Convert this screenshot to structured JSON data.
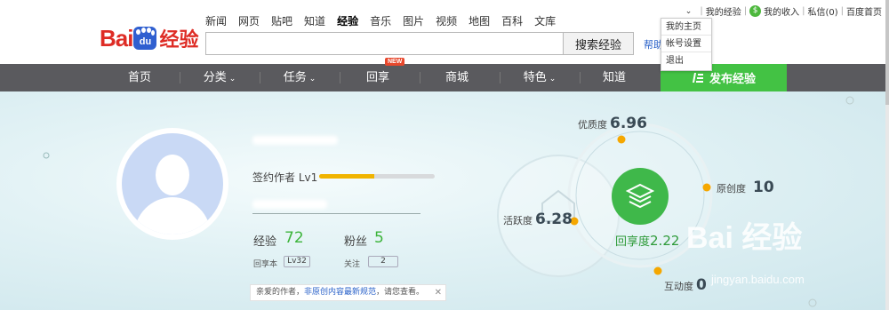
{
  "logo": {
    "bai": "Bai",
    "du": "du",
    "brand": "经验"
  },
  "topnav": [
    {
      "label": "新闻",
      "active": false
    },
    {
      "label": "网页",
      "active": false
    },
    {
      "label": "贴吧",
      "active": false
    },
    {
      "label": "知道",
      "active": false
    },
    {
      "label": "经验",
      "active": true
    },
    {
      "label": "音乐",
      "active": false
    },
    {
      "label": "图片",
      "active": false
    },
    {
      "label": "视频",
      "active": false
    },
    {
      "label": "地图",
      "active": false
    },
    {
      "label": "百科",
      "active": false
    },
    {
      "label": "文库",
      "active": false
    }
  ],
  "search": {
    "button_label": "搜索经验",
    "help_link": "帮助"
  },
  "userbar": {
    "dropdown_arrow": "⌄",
    "my_experience": "我的经验",
    "my_income": "我的收入",
    "money_icon": "$",
    "messages": "私信(0)",
    "baidu_home": "百度首页"
  },
  "dropdown": {
    "items": [
      "我的主页",
      "帐号设置",
      "退出"
    ]
  },
  "mainnav": {
    "items": [
      "首页",
      "分类",
      "任务",
      "回享",
      "商城",
      "特色",
      "知道"
    ],
    "arrows": [
      "",
      "⌄",
      "⌄",
      "",
      "",
      "⌄",
      ""
    ],
    "new_badge": "NEW",
    "publish_label": "发布经验"
  },
  "profile": {
    "level_label": "签约作者 Lv1",
    "level_progress": 0.48,
    "experience_label": "经验",
    "experience_value": "72",
    "fans_label": "粉丝",
    "fans_value": "5",
    "huixiang_label": "回享本",
    "huixiang_value": "Lv32",
    "follow_label": "关注",
    "follow_value": "2",
    "notice_prefix": "亲爱的作者，",
    "notice_link": "非原创内容最新规范",
    "notice_suffix": "，请您查看。",
    "notice_close": "✕"
  },
  "scores": {
    "quality_label": "优质度",
    "quality_value": "6.96",
    "originality_label": "原创度",
    "originality_value": "10",
    "activity_label": "活跃度",
    "activity_value": "6.28",
    "interaction_label": "互动度",
    "interaction_value": "0",
    "huixiang_label": "回享度",
    "huixiang_value": "2.22"
  },
  "watermark": {
    "text": "Bai 经验",
    "url": "jingyan.baidu.com"
  },
  "colors": {
    "accent_green": "#43c244",
    "nav_dark": "#5a5a5e",
    "logo_red": "#de2c25",
    "progress": "#f0b400",
    "score_dot": "#f5a700"
  }
}
